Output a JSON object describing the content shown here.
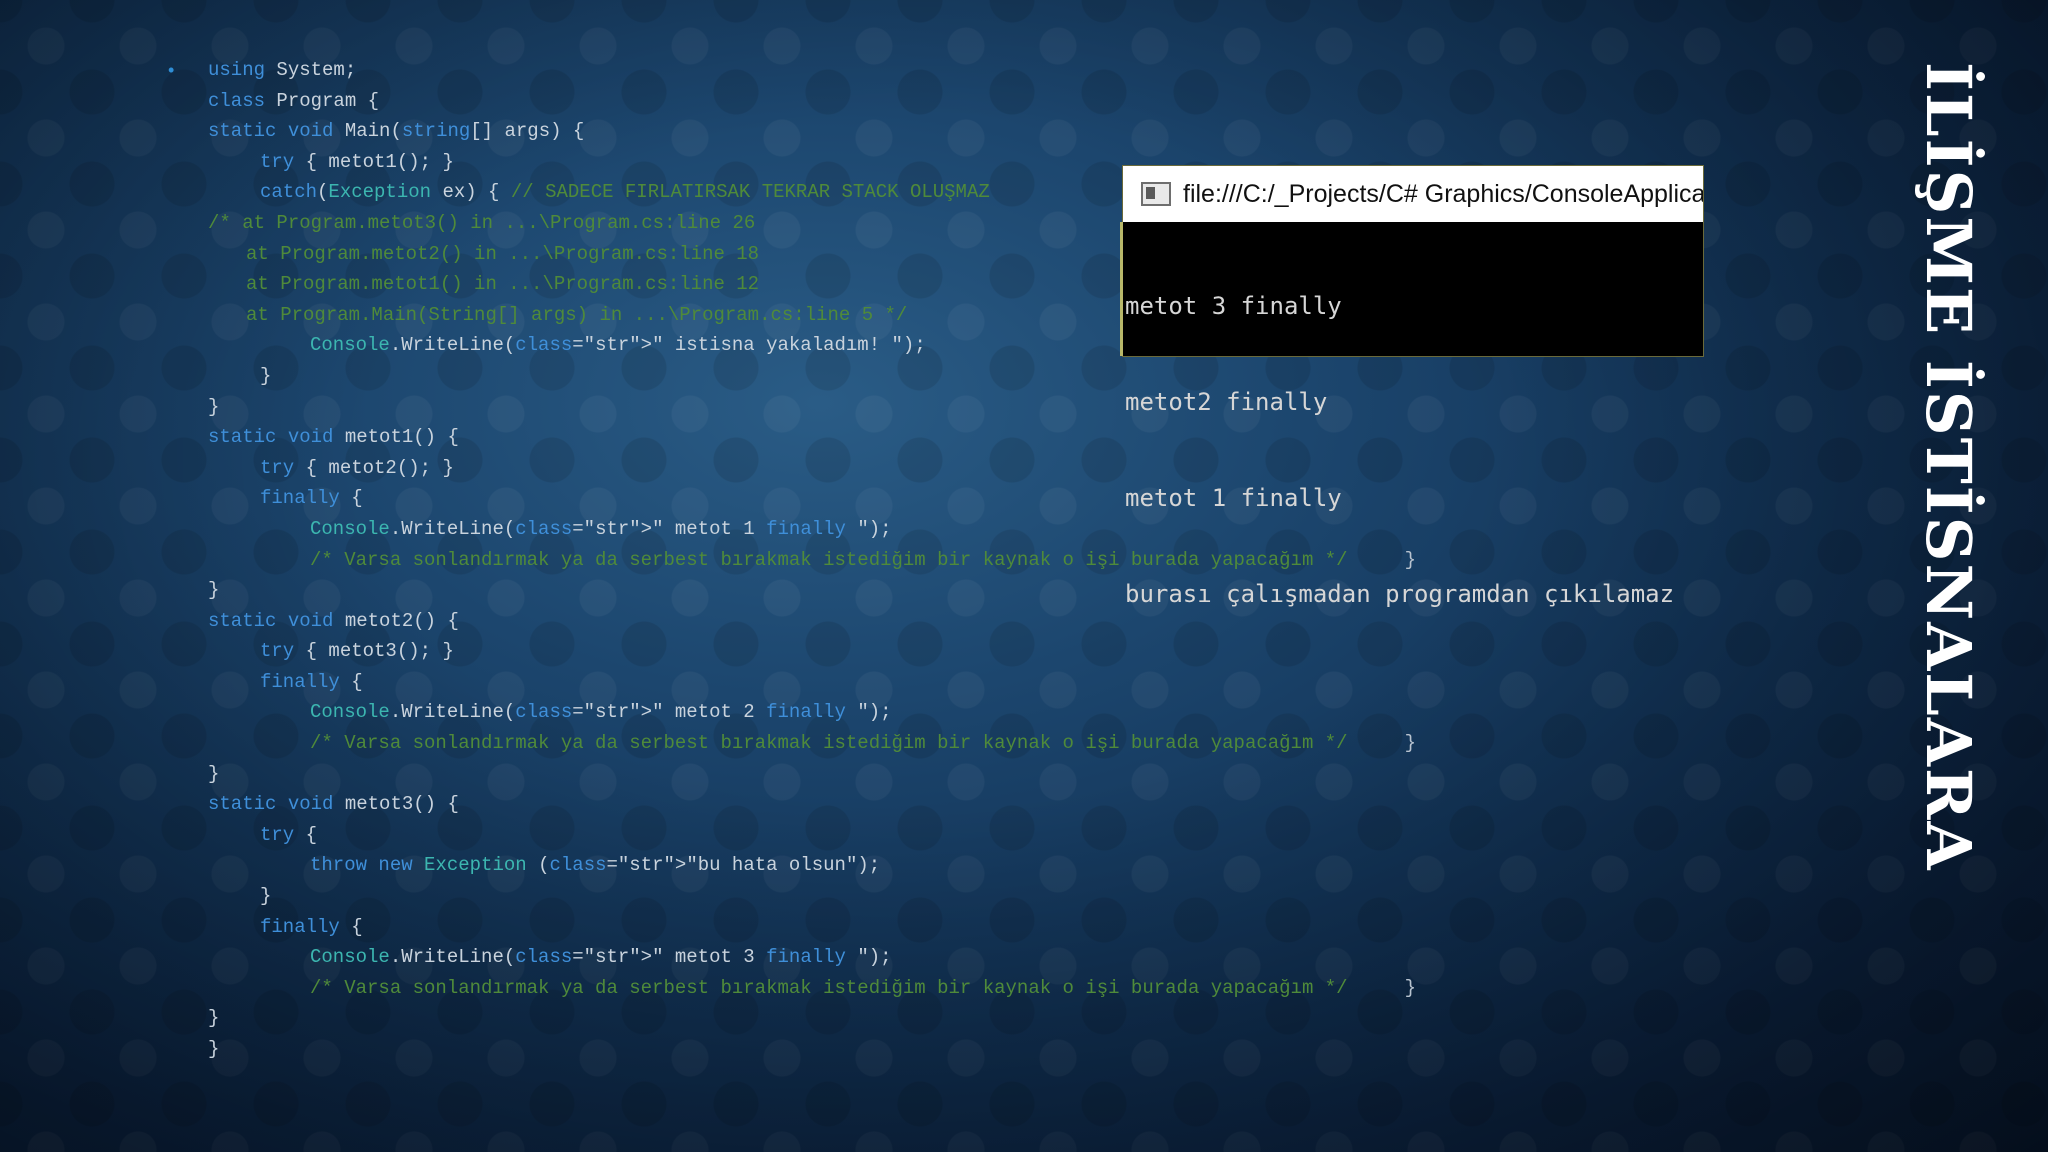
{
  "slide": {
    "title": "İLİŞME İSTİSNALARA"
  },
  "console_window": {
    "title": "file:///C:/_Projects/C# Graphics/ConsoleApplicatio",
    "output": [
      "metot 3 finally",
      "metot2 finally",
      "metot 1 finally",
      "burası çalışmadan programdan çıkılamaz"
    ]
  },
  "code": {
    "bullet": "•",
    "lines": [
      "using System;",
      "class Program {",
      "static void Main(string[] args) {",
      "try { metot1(); }",
      "catch(Exception ex) { // SADECE FIRLATIRSAK TEKRAR STACK OLUŞMAZ",
      "/* at Program.metot3() in ...\\Program.cs:line 26",
      "at Program.metot2() in ...\\Program.cs:line 18",
      "at Program.metot1() in ...\\Program.cs:line 12",
      "at Program.Main(String[] args) in ...\\Program.cs:line 5 */",
      "Console.WriteLine(\" istisna yakaladım! \");",
      "}",
      "}",
      "static void metot1() {",
      "try { metot2(); }",
      "finally {",
      "Console.WriteLine(\" metot 1 finally \");",
      "/* Varsa sonlandırmak ya da serbest bırakmak istediğim bir kaynak o işi burada yapacağım */     }",
      "}",
      "static void metot2() {",
      "try { metot3(); }",
      "finally {",
      "Console.WriteLine(\" metot 2 finally \");",
      "/* Varsa sonlandırmak ya da serbest bırakmak istediğim bir kaynak o işi burada yapacağım */     }",
      "}",
      "static void metot3() {",
      "try {",
      "throw new Exception (\"bu hata olsun\");",
      "}",
      "finally {",
      "Console.WriteLine(\" metot 3 finally \");",
      "/* Varsa sonlandırmak ya da serbest bırakmak istediğim bir kaynak o işi burada yapacağım */     }",
      "}",
      "}"
    ]
  },
  "colors": {
    "keyword": "#3f8fd9",
    "type": "#3cb6b0",
    "string": "#b5507b",
    "comment": "#4f8a3a",
    "background": "#123356"
  }
}
